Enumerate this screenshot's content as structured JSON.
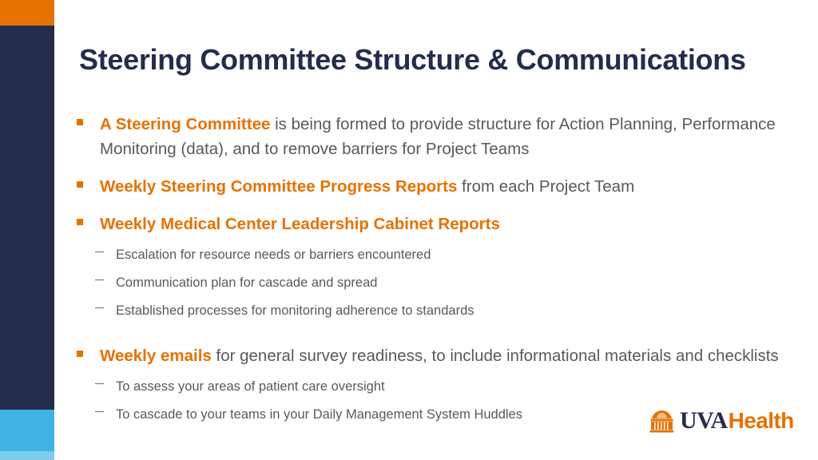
{
  "slide": {
    "title": "Steering Committee Structure & Communications",
    "bullets": [
      {
        "marker": "square-bullet-icon",
        "lead": "A Steering Committee",
        "rest": " is being formed to provide structure for Action Planning, Performance Monitoring (data), and to remove barriers for Project Teams",
        "sub_items": []
      },
      {
        "marker": "square-bullet-icon",
        "lead": "Weekly Steering Committee Progress Reports",
        "rest": " from each Project Team",
        "sub_items": []
      },
      {
        "marker": "square-bullet-icon",
        "lead": "Weekly Medical Center Leadership Cabinet Reports",
        "rest": "",
        "sub_items": [
          "Escalation for resource needs or barriers encountered",
          "Communication plan for cascade and spread",
          "Established processes for monitoring adherence to standards"
        ]
      },
      {
        "marker": "square-bullet-icon",
        "lead": "Weekly emails",
        "rest": " for general survey readiness, to include informational materials and checklists",
        "sub_items": [
          "To assess your areas of patient care oversight",
          "To cascade to your teams in your Daily Management System Huddles"
        ]
      }
    ]
  },
  "logo": {
    "mark": "uva-rotunda-icon",
    "primary": "UVA",
    "secondary": "Health"
  },
  "colors": {
    "brand_orange": "#E57200",
    "brand_navy": "#232D4B",
    "accent_blue": "#3FB3E3",
    "accent_blue_light": "#7FCCEC",
    "body_text": "#595959"
  }
}
